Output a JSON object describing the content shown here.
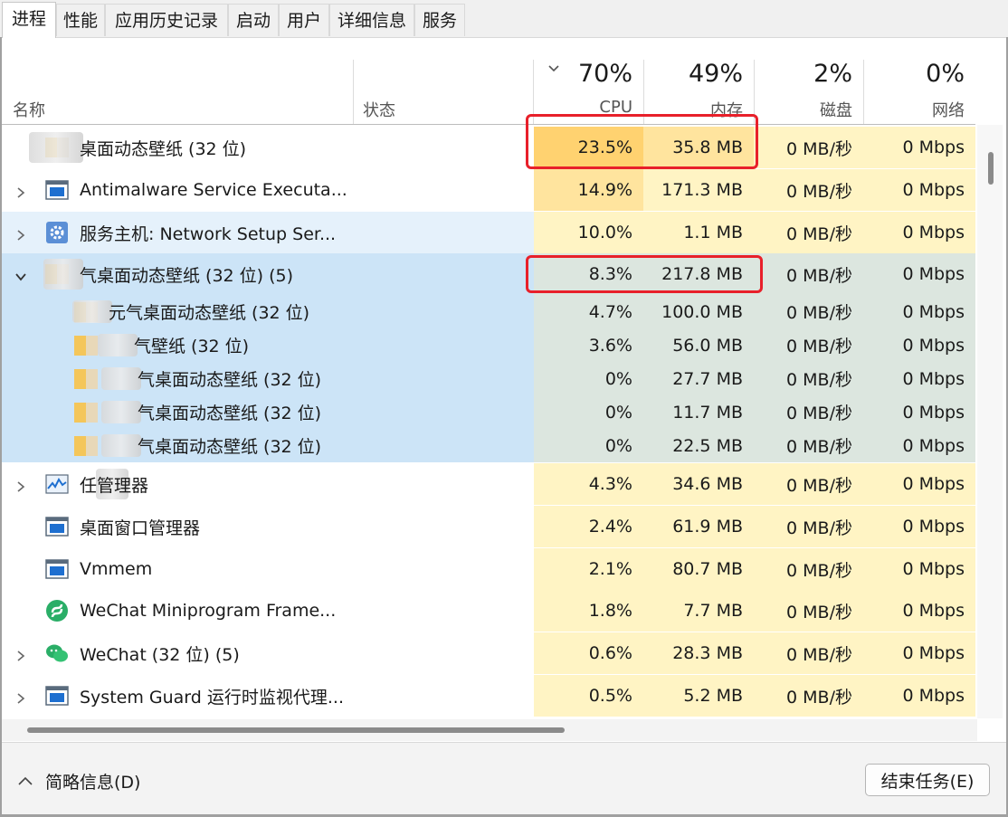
{
  "tabs": [
    {
      "label": "进程",
      "active": true
    },
    {
      "label": "性能"
    },
    {
      "label": "应用历史记录"
    },
    {
      "label": "启动"
    },
    {
      "label": "用户"
    },
    {
      "label": "详细信息"
    },
    {
      "label": "服务"
    }
  ],
  "columns": {
    "name": "名称",
    "status": "状态",
    "cpu": {
      "pct": "70%",
      "label": "CPU"
    },
    "memory": {
      "pct": "49%",
      "label": "内存"
    },
    "disk": {
      "pct": "2%",
      "label": "磁盘"
    },
    "network": {
      "pct": "0%",
      "label": "网络"
    }
  },
  "rows": [
    {
      "name": "桌面动态壁纸 (32 位)",
      "cpu": "23.5%",
      "mem": "35.8 MB",
      "disk": "0 MB/秒",
      "net": "0 Mbps",
      "icon": "blurred-app-icon",
      "expander": "none"
    },
    {
      "name": "Antimalware Service Executa...",
      "cpu": "14.9%",
      "mem": "171.3 MB",
      "disk": "0 MB/秒",
      "net": "0 Mbps",
      "icon": "window-app-icon",
      "expander": "collapsed"
    },
    {
      "name": "服务主机: Network Setup Ser...",
      "cpu": "10.0%",
      "mem": "1.1 MB",
      "disk": "0 MB/秒",
      "net": "0 Mbps",
      "icon": "gear-icon",
      "expander": "collapsed"
    },
    {
      "name": "气桌面动态壁纸 (32 位) (5)",
      "cpu": "8.3%",
      "mem": "217.8 MB",
      "disk": "0 MB/秒",
      "net": "0 Mbps",
      "icon": "blurred-app-icon",
      "expander": "expanded"
    },
    {
      "name": "元气桌面动态壁纸 (32 位)",
      "cpu": "4.7%",
      "mem": "100.0 MB",
      "disk": "0 MB/秒",
      "net": "0 Mbps",
      "icon": "blurred-app-icon",
      "expander": "none"
    },
    {
      "name": "气壁纸 (32 位)",
      "cpu": "3.6%",
      "mem": "56.0 MB",
      "disk": "0 MB/秒",
      "net": "0 Mbps",
      "icon": "blurred-app-icon",
      "expander": "none"
    },
    {
      "name": "气桌面动态壁纸 (32 位)",
      "cpu": "0%",
      "mem": "27.7 MB",
      "disk": "0 MB/秒",
      "net": "0 Mbps",
      "icon": "blurred-app-icon",
      "expander": "none"
    },
    {
      "name": "气桌面动态壁纸 (32 位)",
      "cpu": "0%",
      "mem": "11.7 MB",
      "disk": "0 MB/秒",
      "net": "0 Mbps",
      "icon": "blurred-app-icon",
      "expander": "none"
    },
    {
      "name": "气桌面动态壁纸 (32 位)",
      "cpu": "0%",
      "mem": "22.5 MB",
      "disk": "0 MB/秒",
      "net": "0 Mbps",
      "icon": "blurred-app-icon",
      "expander": "none"
    },
    {
      "name": "任管理器",
      "cpu": "4.3%",
      "mem": "34.6 MB",
      "disk": "0 MB/秒",
      "net": "0 Mbps",
      "icon": "task-manager-icon",
      "expander": "collapsed"
    },
    {
      "name": "桌面窗口管理器",
      "cpu": "2.4%",
      "mem": "61.9 MB",
      "disk": "0 MB/秒",
      "net": "0 Mbps",
      "icon": "window-app-icon",
      "expander": "none"
    },
    {
      "name": "Vmmem",
      "cpu": "2.1%",
      "mem": "80.7 MB",
      "disk": "0 MB/秒",
      "net": "0 Mbps",
      "icon": "window-app-icon",
      "expander": "none"
    },
    {
      "name": "WeChat Miniprogram Frame...",
      "cpu": "1.8%",
      "mem": "7.7 MB",
      "disk": "0 MB/秒",
      "net": "0 Mbps",
      "icon": "wechat-miniprogram-icon",
      "expander": "none"
    },
    {
      "name": "WeChat (32 位) (5)",
      "cpu": "0.6%",
      "mem": "28.3 MB",
      "disk": "0 MB/秒",
      "net": "0 Mbps",
      "icon": "wechat-icon",
      "expander": "collapsed"
    },
    {
      "name": "System Guard 运行时监视代理...",
      "cpu": "0.5%",
      "mem": "5.2 MB",
      "disk": "0 MB/秒",
      "net": "0 Mbps",
      "icon": "window-app-icon",
      "expander": "collapsed"
    }
  ],
  "footer": {
    "brief_label": "简略信息(D)",
    "end_task_label": "结束任务(E)"
  },
  "colors": {
    "heat_strong": "#ffd270",
    "heat_medium": "#ffe49e",
    "heat_light": "#fff4c4",
    "selected_row": "#cce4f7",
    "annotation_red": "#e8202a"
  }
}
